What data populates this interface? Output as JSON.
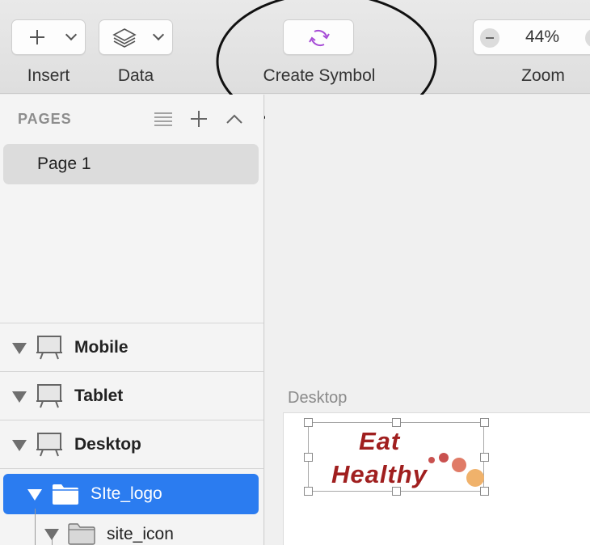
{
  "toolbar": {
    "insert_label": "Insert",
    "data_label": "Data",
    "create_symbol_label": "Create Symbol",
    "zoom_label": "Zoom",
    "zoom_value": "44%",
    "create_symbol_icon": "create-symbol-icon",
    "accent_color": "#a64bd6"
  },
  "sidebar": {
    "pages_title": "PAGES",
    "pages": [
      {
        "label": "Page 1"
      }
    ],
    "layers": [
      {
        "label": "Mobile",
        "icon": "artboard-icon"
      },
      {
        "label": "Tablet",
        "icon": "artboard-icon"
      },
      {
        "label": "Desktop",
        "icon": "artboard-icon"
      }
    ],
    "selected_layer": {
      "label": "SIte_logo",
      "icon": "folder-icon",
      "color": "#2b7cf0"
    },
    "child_layer": {
      "label": "site_icon",
      "icon": "folder-icon"
    }
  },
  "canvas": {
    "artboard_name": "Desktop",
    "logo": {
      "line1": "Eat",
      "line2": "Healthy",
      "text_color": "#a01f1f",
      "dot_colors": [
        "#c9514f",
        "#c9514f",
        "#e07b67",
        "#f0b26b"
      ]
    }
  }
}
